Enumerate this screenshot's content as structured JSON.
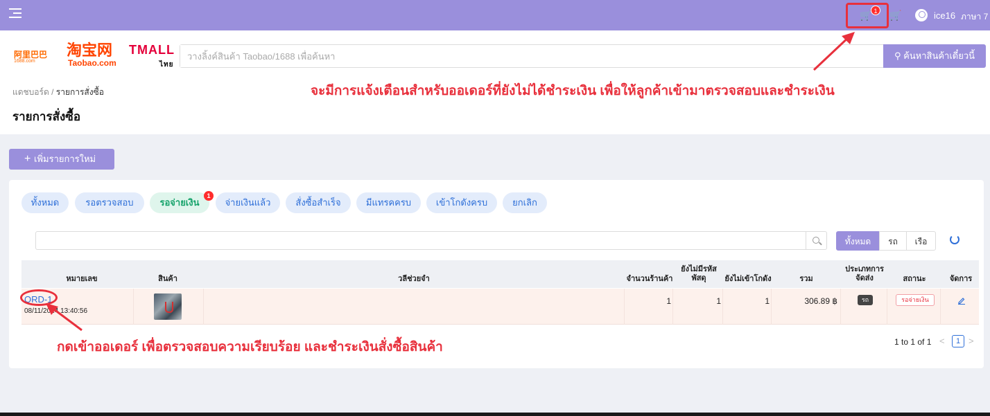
{
  "topbar": {
    "cart_badge": "1",
    "username": "ice16",
    "language": "ภาษา 7"
  },
  "header": {
    "logo_1688": "阿里巴巴",
    "logo_1688_sub": "1688.com",
    "logo_taobao": "淘宝网",
    "logo_taobao_sub": "Taobao.com",
    "logo_tmall": "TMALL",
    "logo_tmall_mark": "ไทย",
    "search_placeholder": "วางลิ้งค์สินค้า Taobao/1688 เพื่อค้นหา",
    "search_button": "ค้นหาสินค้าเดี๋ยวนี้"
  },
  "annotations": {
    "top": "จะมีการแจ้งเตือนสำหรับออเดอร์ที่ยังไม่ได้ชำระเงิน  เพื่อให้ลูกค้าเข้ามาตรวจสอบและชำระเงิน",
    "bottom": "กดเข้าออเดอร์  เพื่อตรวจสอบความเรียบร้อย  และชำระเงินสั่งซื้อสินค้า",
    "highlight_color": "#e8303c"
  },
  "breadcrumb": {
    "home": "แดชบอร์ด",
    "separator": "/",
    "current": "รายการสั่งซื้อ"
  },
  "page_title": "รายการสั่งซื้อ",
  "add_button": "เพิ่มรายการใหม่",
  "tabs": [
    {
      "label": "ทั้งหมด"
    },
    {
      "label": "รอตรวจสอบ"
    },
    {
      "label": "รอจ่ายเงิน",
      "badge": "1",
      "active": true
    },
    {
      "label": "จ่ายเงินแล้ว"
    },
    {
      "label": "สั่งซื้อสำเร็จ"
    },
    {
      "label": "มีแทรคครบ"
    },
    {
      "label": "เข้าโกดังครบ"
    },
    {
      "label": "ยกเลิก"
    }
  ],
  "filter": {
    "segments": [
      "ทั้งหมด",
      "รถ",
      "เรือ"
    ],
    "active_segment": "ทั้งหมด"
  },
  "table": {
    "headers": [
      "หมายเลข",
      "สินค้า",
      "วลีช่วยจำ",
      "จำนวนร้านค้า",
      "ยังไม่มีรหัส พัสดุ",
      "ยังไม่เข้าโกดัง",
      "รวม",
      "ประเภทการ จัดส่ง",
      "สถานะ",
      "จัดการ"
    ],
    "rows": [
      {
        "order_id": "ORD-1",
        "date": "08/11/2024 13:40:56",
        "memo": "",
        "shop_count": "1",
        "no_tracking": "1",
        "not_in_warehouse": "1",
        "total": "306.89 ฿",
        "shipping_type": "รถ",
        "status": "รอจ่ายเงิน"
      }
    ]
  },
  "pagination": {
    "summary": "1 to 1 of 1",
    "prev": "<",
    "page": "1",
    "next": ">"
  },
  "colors": {
    "accent": "#9a8fdc",
    "link": "#2e6fd8",
    "active_tab": "#16a36b",
    "row_highlight": "#fdf1ec"
  }
}
